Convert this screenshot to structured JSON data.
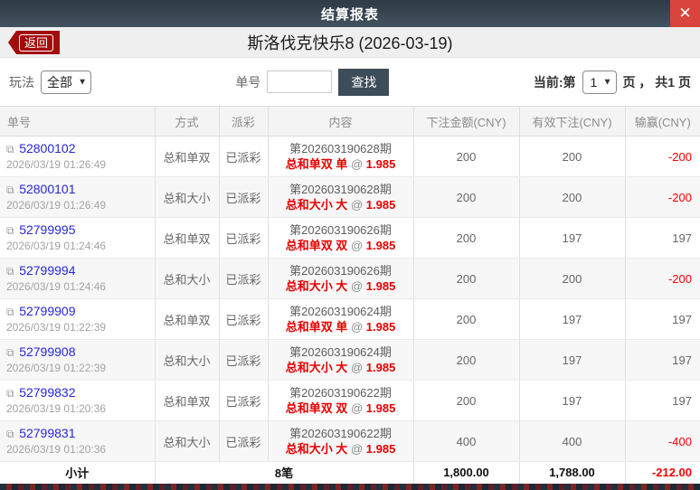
{
  "colors": {
    "titlebar_bg": "#3f4e5a",
    "close_red": "#d9443c",
    "back_red": "#a50b0b",
    "link_blue": "#2626d9",
    "bet_red": "#e60000",
    "negative_red": "#ff0000",
    "header_text_gray": "#8c8c8c"
  },
  "icons": {
    "close": "✕",
    "copy": "⧉",
    "chevron": "▼"
  },
  "titlebar": {
    "title": "结算报表"
  },
  "subheader": {
    "back_label": "返回",
    "title": "斯洛伐克快乐8 (2026-03-19)"
  },
  "filters": {
    "playtype_label": "玩法",
    "playtype_value": "全部",
    "order_label": "单号",
    "order_value": "",
    "search_label": "查找",
    "page_prefix": "当前:第",
    "page_value": "1",
    "page_suffix": "页 ， 共1 页"
  },
  "table": {
    "columns": [
      "单号",
      "方式",
      "派彩",
      "内容",
      "下注金额(CNY)",
      "有效下注(CNY)",
      "输赢(CNY)"
    ],
    "at_symbol": "@",
    "rows": [
      {
        "order_no": "52800102",
        "datetime": "2026/03/19 01:26:49",
        "method": "总和单双",
        "payout": "已派彩",
        "period": "第202603190628期",
        "bet": "总和单双 单",
        "odds": "1.985",
        "amount": "200",
        "valid": "200",
        "winloss": "-200"
      },
      {
        "order_no": "52800101",
        "datetime": "2026/03/19 01:26:49",
        "method": "总和大小",
        "payout": "已派彩",
        "period": "第202603190628期",
        "bet": "总和大小 大",
        "odds": "1.985",
        "amount": "200",
        "valid": "200",
        "winloss": "-200"
      },
      {
        "order_no": "52799995",
        "datetime": "2026/03/19 01:24:46",
        "method": "总和单双",
        "payout": "已派彩",
        "period": "第202603190626期",
        "bet": "总和单双 双",
        "odds": "1.985",
        "amount": "200",
        "valid": "197",
        "winloss": "197"
      },
      {
        "order_no": "52799994",
        "datetime": "2026/03/19 01:24:46",
        "method": "总和大小",
        "payout": "已派彩",
        "period": "第202603190626期",
        "bet": "总和大小 大",
        "odds": "1.985",
        "amount": "200",
        "valid": "200",
        "winloss": "-200"
      },
      {
        "order_no": "52799909",
        "datetime": "2026/03/19 01:22:39",
        "method": "总和单双",
        "payout": "已派彩",
        "period": "第202603190624期",
        "bet": "总和单双 单",
        "odds": "1.985",
        "amount": "200",
        "valid": "197",
        "winloss": "197"
      },
      {
        "order_no": "52799908",
        "datetime": "2026/03/19 01:22:39",
        "method": "总和大小",
        "payout": "已派彩",
        "period": "第202603190624期",
        "bet": "总和大小 大",
        "odds": "1.985",
        "amount": "200",
        "valid": "197",
        "winloss": "197"
      },
      {
        "order_no": "52799832",
        "datetime": "2026/03/19 01:20:36",
        "method": "总和单双",
        "payout": "已派彩",
        "period": "第202603190622期",
        "bet": "总和单双 双",
        "odds": "1.985",
        "amount": "200",
        "valid": "197",
        "winloss": "197"
      },
      {
        "order_no": "52799831",
        "datetime": "2026/03/19 01:20:36",
        "method": "总和大小",
        "payout": "已派彩",
        "period": "第202603190622期",
        "bet": "总和大小 大",
        "odds": "1.985",
        "amount": "400",
        "valid": "400",
        "winloss": "-400"
      }
    ],
    "footer": {
      "label": "小计",
      "count": "8笔",
      "amount": "1,800.00",
      "valid": "1,788.00",
      "winloss": "-212.00"
    }
  }
}
